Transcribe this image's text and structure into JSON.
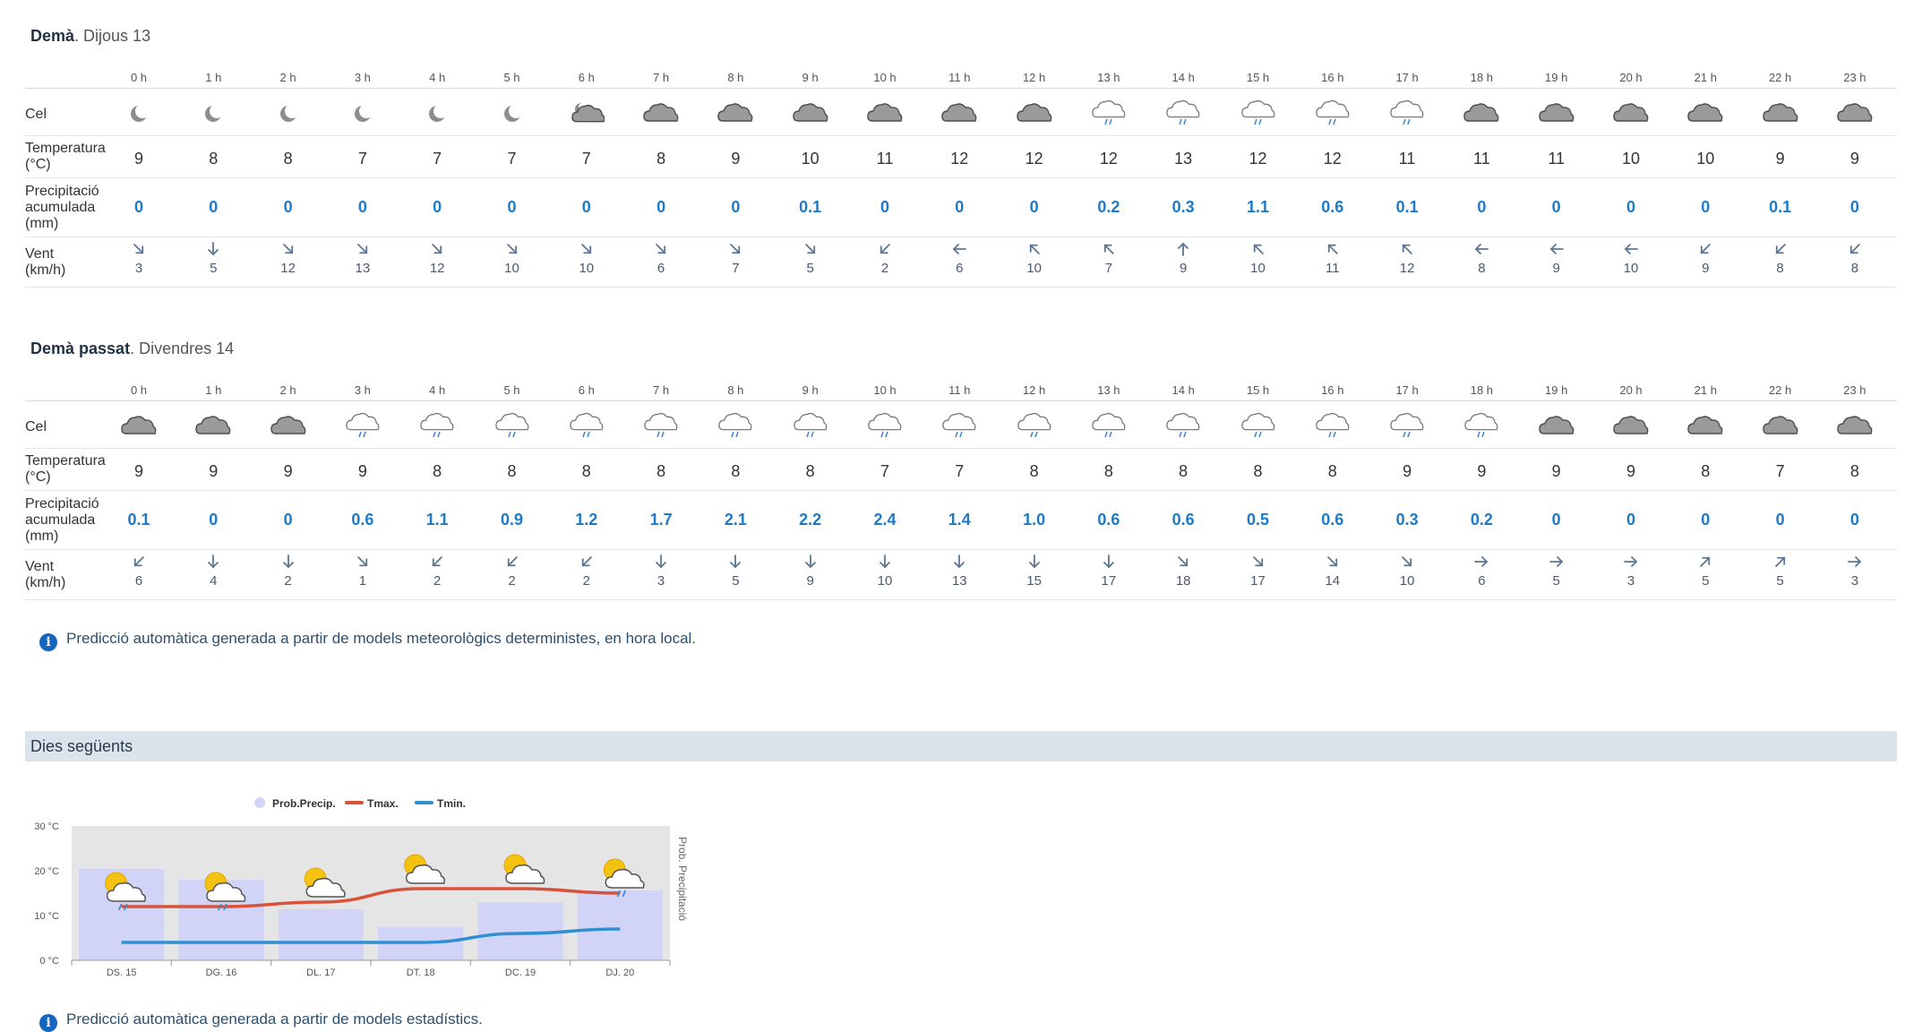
{
  "hours": [
    "0 h",
    "1 h",
    "2 h",
    "3 h",
    "4 h",
    "5 h",
    "6 h",
    "7 h",
    "8 h",
    "9 h",
    "10 h",
    "11 h",
    "12 h",
    "13 h",
    "14 h",
    "15 h",
    "16 h",
    "17 h",
    "18 h",
    "19 h",
    "20 h",
    "21 h",
    "22 h",
    "23 h"
  ],
  "row_labels": {
    "sky": "Cel",
    "temp_1": "Temperatura",
    "temp_2": "(°C)",
    "prec_1": "Precipitació",
    "prec_2": "acumulada",
    "prec_3": "(mm)",
    "wind_1": "Vent",
    "wind_2": "(km/h)"
  },
  "day1": {
    "title_bold": "Demà",
    "title_rest": ". Dijous 13",
    "sky": [
      "moon",
      "moon",
      "moon",
      "moon",
      "moon",
      "moon",
      "moon-cloud",
      "cloud",
      "cloud",
      "cloud",
      "cloud",
      "cloud",
      "cloud",
      "rain",
      "rain",
      "rain",
      "rain",
      "rain",
      "cloud",
      "cloud",
      "cloud",
      "cloud",
      "cloud",
      "cloud"
    ],
    "temp": [
      "9",
      "8",
      "8",
      "7",
      "7",
      "7",
      "7",
      "8",
      "9",
      "10",
      "11",
      "12",
      "12",
      "12",
      "13",
      "12",
      "12",
      "11",
      "11",
      "11",
      "10",
      "10",
      "9",
      "9"
    ],
    "prec": [
      "0",
      "0",
      "0",
      "0",
      "0",
      "0",
      "0",
      "0",
      "0",
      "0.1",
      "0",
      "0",
      "0",
      "0.2",
      "0.3",
      "1.1",
      "0.6",
      "0.1",
      "0",
      "0",
      "0",
      "0",
      "0.1",
      "0"
    ],
    "wind_dir": [
      "SE",
      "S",
      "SE",
      "SE",
      "SE",
      "SE",
      "SE",
      "SE",
      "SE",
      "SE",
      "SW",
      "W",
      "NW",
      "NW",
      "N",
      "NW",
      "NW",
      "NW",
      "W",
      "W",
      "W",
      "SW",
      "SW",
      "SW"
    ],
    "wind_speed": [
      "3",
      "5",
      "12",
      "13",
      "12",
      "10",
      "10",
      "6",
      "7",
      "5",
      "2",
      "6",
      "10",
      "7",
      "9",
      "10",
      "11",
      "12",
      "8",
      "9",
      "10",
      "9",
      "8",
      "8"
    ]
  },
  "day2": {
    "title_bold": "Demà passat",
    "title_rest": ". Divendres 14",
    "sky": [
      "cloud",
      "cloud",
      "cloud",
      "rain",
      "rain",
      "rain",
      "rain",
      "rain",
      "rain",
      "rain",
      "rain",
      "rain",
      "rain",
      "rain",
      "rain",
      "rain",
      "rain",
      "rain",
      "rain",
      "cloud",
      "cloud",
      "cloud",
      "cloud",
      "cloud"
    ],
    "temp": [
      "9",
      "9",
      "9",
      "9",
      "8",
      "8",
      "8",
      "8",
      "8",
      "8",
      "7",
      "7",
      "8",
      "8",
      "8",
      "8",
      "8",
      "9",
      "9",
      "9",
      "9",
      "8",
      "7",
      "8"
    ],
    "prec": [
      "0.1",
      "0",
      "0",
      "0.6",
      "1.1",
      "0.9",
      "1.2",
      "1.7",
      "2.1",
      "2.2",
      "2.4",
      "1.4",
      "1.0",
      "0.6",
      "0.6",
      "0.5",
      "0.6",
      "0.3",
      "0.2",
      "0",
      "0",
      "0",
      "0",
      "0"
    ],
    "wind_dir": [
      "SW",
      "S",
      "S",
      "SE",
      "SW",
      "SW",
      "SW",
      "S",
      "S",
      "S",
      "S",
      "S",
      "S",
      "S",
      "SE",
      "SE",
      "SE",
      "SE",
      "E",
      "E",
      "E",
      "NE",
      "NE",
      "E"
    ],
    "wind_speed": [
      "6",
      "4",
      "2",
      "1",
      "2",
      "2",
      "2",
      "3",
      "5",
      "9",
      "10",
      "13",
      "15",
      "17",
      "18",
      "17",
      "14",
      "10",
      "6",
      "5",
      "3",
      "5",
      "5",
      "3"
    ]
  },
  "note_deterministic": "Predicció automàtica generada a partir de models meteorològics deterministes, en hora local.",
  "section_title": "Dies següents",
  "note_statistical": "Predicció automàtica generada a partir de models estadístics.",
  "colors": {
    "tmax": "#d9533a",
    "tmin": "#2f8fd0",
    "precip_bar": "#d2d4f7",
    "precip_accent": "#1d7ac9",
    "arrow": "#5b7694",
    "section_bg": "#dbe3ec"
  },
  "chart_data": {
    "type": "bar",
    "legend": [
      "Prob.Precip.",
      "Tmax.",
      "Tmin."
    ],
    "legend_position": "top",
    "categories": [
      "DS. 15",
      "DG. 16",
      "DL. 17",
      "DT. 18",
      "DC. 19",
      "DJ. 20"
    ],
    "yticks": [
      "30 °C",
      "20 °C",
      "10 °C",
      "0 °C"
    ],
    "ylim": [
      0,
      30
    ],
    "y2label": "Prob. Precipitació",
    "series": [
      {
        "name": "Prob.Precip.",
        "type": "bar",
        "values": [
          68,
          60,
          38,
          25,
          43,
          52
        ]
      },
      {
        "name": "Tmax.",
        "type": "line",
        "values": [
          12,
          12,
          13,
          16,
          16,
          15
        ]
      },
      {
        "name": "Tmin.",
        "type": "line",
        "values": [
          4,
          4,
          4,
          4,
          6,
          7
        ]
      }
    ],
    "icons": [
      "sun-cloud-rain",
      "sun-cloud-rain",
      "sun-cloud",
      "sun-cloud",
      "sun-cloud",
      "sun-cloud-rain"
    ],
    "grid": false
  }
}
